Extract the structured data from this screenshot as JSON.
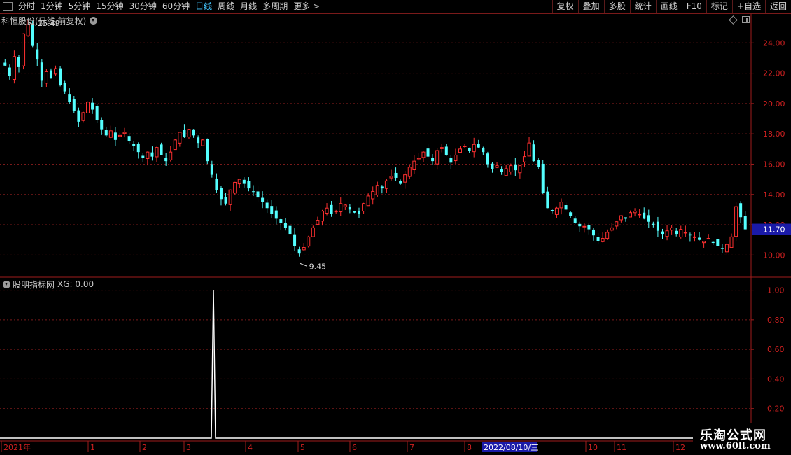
{
  "toolbar": {
    "periods": [
      "分时",
      "1分钟",
      "5分钟",
      "15分钟",
      "30分钟",
      "60分钟",
      "日线",
      "周线",
      "月线",
      "多周期",
      "更多 >"
    ],
    "active_period": "日线",
    "tools": [
      "复权",
      "叠加",
      "多股",
      "统计",
      "画线",
      "F10",
      "标记",
      "+自选",
      "返回"
    ]
  },
  "main_chart": {
    "title": "科恒股份(日线,前复权)",
    "high_label": "25.49",
    "low_label": "9.45",
    "last_price": "11.70",
    "price_ticks": [
      "24.00",
      "22.00",
      "20.00",
      "18.00",
      "16.00",
      "14.00",
      "12.00",
      "10.00"
    ]
  },
  "indicator": {
    "title": "股朋指标网",
    "xg_label": "XG: 0.00",
    "ticks": [
      "1.00",
      "0.80",
      "0.60",
      "0.40",
      "0.20"
    ]
  },
  "time_axis": {
    "labels": [
      "2021年",
      "1",
      "2",
      "3",
      "4",
      "5",
      "6",
      "7",
      "8",
      "10",
      "11",
      "12"
    ],
    "cursor_date": "2022/08/10/三"
  },
  "watermark": {
    "name": "乐淘公式网",
    "url": "www.60lt.com"
  },
  "colors": {
    "up": "#ff3030",
    "down": "#54ffff",
    "grid": "#7a1a1a",
    "axis": "#a01c1c",
    "last_price_bg": "#1a1aa8",
    "active_tab": "#44c6ff"
  },
  "chart_data": {
    "type": "candlestick",
    "y_unit": "CNY",
    "ylim": [
      9.0,
      26.0
    ],
    "close_path": [
      22.5,
      21.8,
      23.1,
      22.4,
      24.6,
      25.2,
      23.8,
      22.9,
      21.5,
      22.1,
      21.7,
      22.3,
      21.2,
      20.8,
      20.1,
      19.5,
      18.8,
      19.4,
      20.1,
      19.6,
      18.9,
      18.3,
      17.9,
      18.2,
      17.6,
      17.9,
      18.1,
      17.5,
      17.2,
      16.8,
      16.4,
      16.8,
      16.5,
      17.1,
      16.6,
      16.2,
      16.8,
      17.6,
      18.1,
      17.8,
      18.3,
      17.9,
      17.4,
      17.6,
      16.2,
      15.3,
      14.3,
      13.7,
      13.4,
      14.3,
      14.8,
      15.0,
      14.7,
      14.4,
      14.2,
      13.8,
      13.5,
      13.1,
      12.7,
      12.4,
      12.1,
      11.8,
      11.4,
      10.6,
      10.1,
      10.5,
      11.2,
      11.8,
      12.3,
      12.9,
      13.1,
      12.7,
      12.9,
      13.4,
      13.3,
      13.0,
      12.8,
      12.7,
      13.4,
      13.9,
      14.2,
      14.6,
      14.4,
      14.9,
      15.2,
      15.1,
      14.7,
      15.3,
      15.8,
      16.2,
      16.4,
      16.8,
      16.5,
      16.2,
      16.9,
      17.1,
      16.6,
      16.1,
      16.6,
      17.0,
      17.2,
      16.9,
      17.3,
      17.1,
      16.8,
      16.0,
      15.7,
      15.9,
      15.5,
      15.7,
      15.9,
      15.6,
      15.9,
      16.5,
      17.4,
      16.2,
      15.8,
      14.1,
      13.1,
      12.9,
      13.1,
      13.5,
      13.0,
      12.6,
      12.1,
      11.9,
      11.9,
      11.7,
      11.3,
      10.9,
      11.1,
      11.5,
      11.8,
      12.2,
      12.6,
      12.4,
      12.8,
      12.9,
      12.7,
      12.4,
      12.2,
      12.0,
      11.6,
      11.4,
      11.6,
      11.8,
      11.4,
      11.7,
      11.5,
      11.3,
      11.2,
      11.0,
      10.9,
      11.1,
      10.8,
      10.6,
      10.4,
      10.7,
      11.2,
      13.2,
      12.5,
      11.7
    ],
    "high": 25.49,
    "low": 9.45,
    "last": 11.7,
    "indicator": {
      "name": "XG",
      "ylim": [
        0,
        1.05
      ],
      "signal": {
        "date_label": "3月末",
        "value": 1.0
      }
    }
  }
}
